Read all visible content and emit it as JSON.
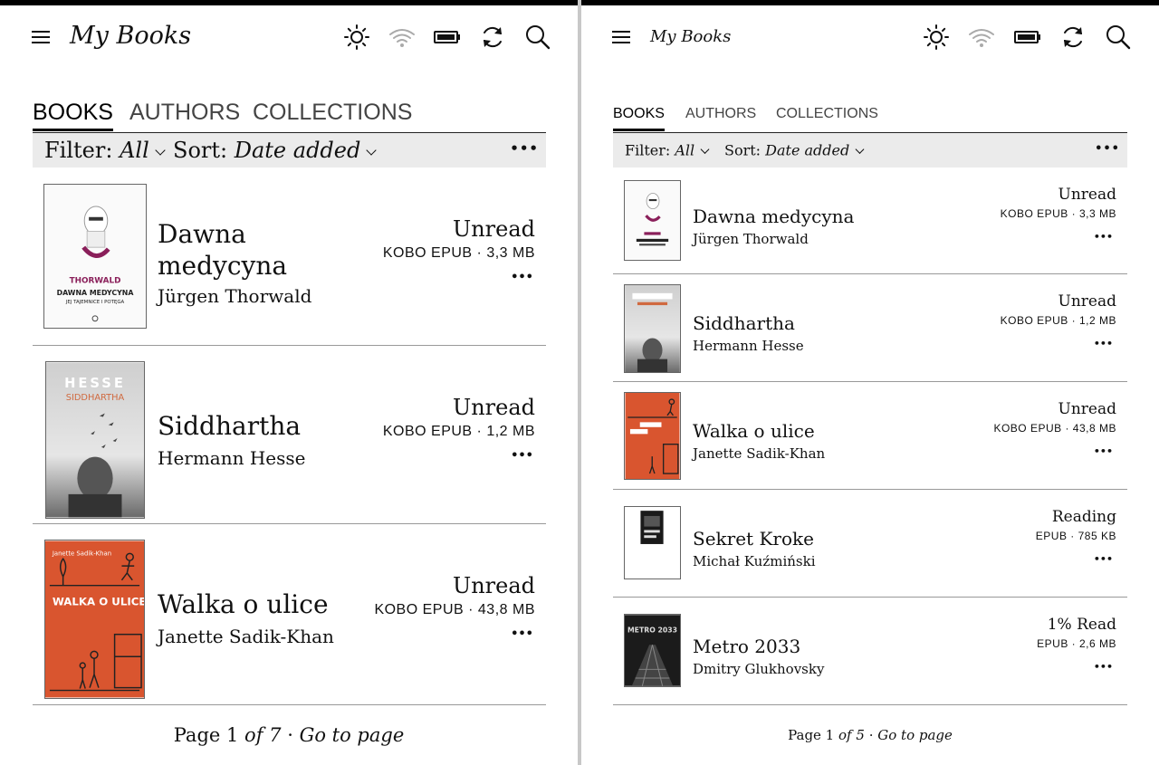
{
  "left": {
    "header": {
      "title": "My Books"
    },
    "tabs": [
      "BOOKS",
      "AUTHORS",
      "COLLECTIONS"
    ],
    "filter": {
      "filter_label": "Filter:",
      "filter_value": "All",
      "sort_label": "Sort:",
      "sort_value": "Date added",
      "more": "•••"
    },
    "books": [
      {
        "title_line1": "Dawna",
        "title_line2": "medycyna",
        "author": "Jürgen Thorwald",
        "status": "Unread",
        "meta": "KOBO EPUB · 3,3 MB",
        "more": "•••",
        "cover_brand": "THORWALD",
        "cover_title": "DAWNA MEDYCYNA",
        "cover_sub": "JEJ TAJEMNICE I POTĘGA"
      },
      {
        "title": "Siddhartha",
        "author": "Hermann Hesse",
        "status": "Unread",
        "meta": "KOBO EPUB · 1,2 MB",
        "more": "•••",
        "cover_brand": "HESSE",
        "cover_title": "SIDDHARTHA"
      },
      {
        "title": "Walka o ulice",
        "author": "Janette Sadik-Khan",
        "status": "Unread",
        "meta": "KOBO EPUB · 43,8 MB",
        "more": "•••",
        "cover_brand": "Janette Sadik-Khan",
        "cover_title": "WALKA O ULICE"
      }
    ],
    "footer": {
      "page": "Page 1",
      "of": "of 7",
      "sep": "·",
      "goto": "Go to page"
    }
  },
  "right": {
    "header": {
      "title": "My Books"
    },
    "tabs": [
      "BOOKS",
      "AUTHORS",
      "COLLECTIONS"
    ],
    "filter": {
      "filter_label": "Filter:",
      "filter_value": "All",
      "sort_label": "Sort:",
      "sort_value": "Date added",
      "more": "•••"
    },
    "books": [
      {
        "title": "Dawna medycyna",
        "author": "Jürgen Thorwald",
        "status": "Unread",
        "meta": "KOBO EPUB · 3,3 MB",
        "more": "•••"
      },
      {
        "title": "Siddhartha",
        "author": "Hermann Hesse",
        "status": "Unread",
        "meta": "KOBO EPUB · 1,2 MB",
        "more": "•••"
      },
      {
        "title": "Walka o ulice",
        "author": "Janette Sadik-Khan",
        "status": "Unread",
        "meta": "KOBO EPUB · 43,8 MB",
        "more": "•••"
      },
      {
        "title": "Sekret Kroke",
        "author": "Michał Kuźmiński",
        "status": "Reading",
        "meta": "EPUB · 785 KB",
        "more": "•••"
      },
      {
        "title": "Metro 2033",
        "author": "Dmitry Glukhovsky",
        "status": "1% Read",
        "meta": "EPUB · 2,6 MB",
        "more": "•••",
        "cover_title": "METRO 2033"
      }
    ],
    "footer": {
      "page": "Page 1",
      "of": "of 5",
      "sep": "·",
      "goto": "Go to page"
    }
  },
  "icons": {
    "menu": "hamburger-menu-icon",
    "brightness": "sun-icon",
    "wifi": "wifi-icon",
    "battery": "battery-icon",
    "sync": "sync-icon",
    "search": "search-icon"
  },
  "colors": {
    "filterbar_bg": "#ebebeb",
    "walka_cover": "#d9552f",
    "thorwald_accent": "#8a1f5a"
  }
}
